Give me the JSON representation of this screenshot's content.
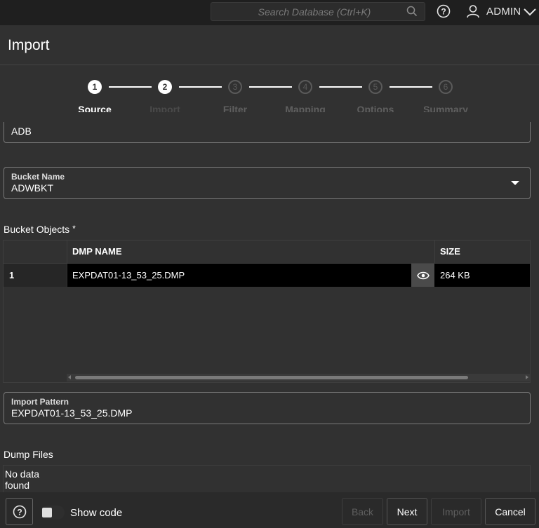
{
  "topbar": {
    "search_placeholder": "Search Database (Ctrl+K)",
    "user_name": "ADMIN"
  },
  "header": {
    "title": "Import"
  },
  "stepper": {
    "steps": [
      {
        "number": "1",
        "label": "Source",
        "state": "active"
      },
      {
        "number": "2",
        "label": "Import",
        "state": "current"
      },
      {
        "number": "3",
        "label": "Filter",
        "state": "pending"
      },
      {
        "number": "4",
        "label": "Mapping",
        "state": "pending"
      },
      {
        "number": "5",
        "label": "Options",
        "state": "pending"
      },
      {
        "number": "6",
        "label": "Summary",
        "state": "pending"
      }
    ]
  },
  "source_field": {
    "value": "ADB"
  },
  "bucket_field": {
    "label": "Bucket Name",
    "value": "ADWBKT"
  },
  "bucket_objects": {
    "label": "Bucket Objects",
    "required_marker": "*",
    "columns": [
      "DMP NAME",
      "SIZE"
    ],
    "rows": [
      {
        "num": "1",
        "name": "EXPDAT01-13_53_25.DMP",
        "size": "264 KB"
      }
    ]
  },
  "import_pattern": {
    "label": "Import Pattern",
    "value": "EXPDAT01-13_53_25.DMP"
  },
  "dump_files": {
    "label": "Dump Files",
    "empty_text": "No data found"
  },
  "footer": {
    "show_code_label": "Show code",
    "back_label": "Back",
    "next_label": "Next",
    "import_label": "Import",
    "cancel_label": "Cancel"
  },
  "colors": {
    "background": "#313131",
    "topbar": "#1f1f1f",
    "selected_row": "#000000",
    "disabled_text": "#5f5f5f"
  }
}
